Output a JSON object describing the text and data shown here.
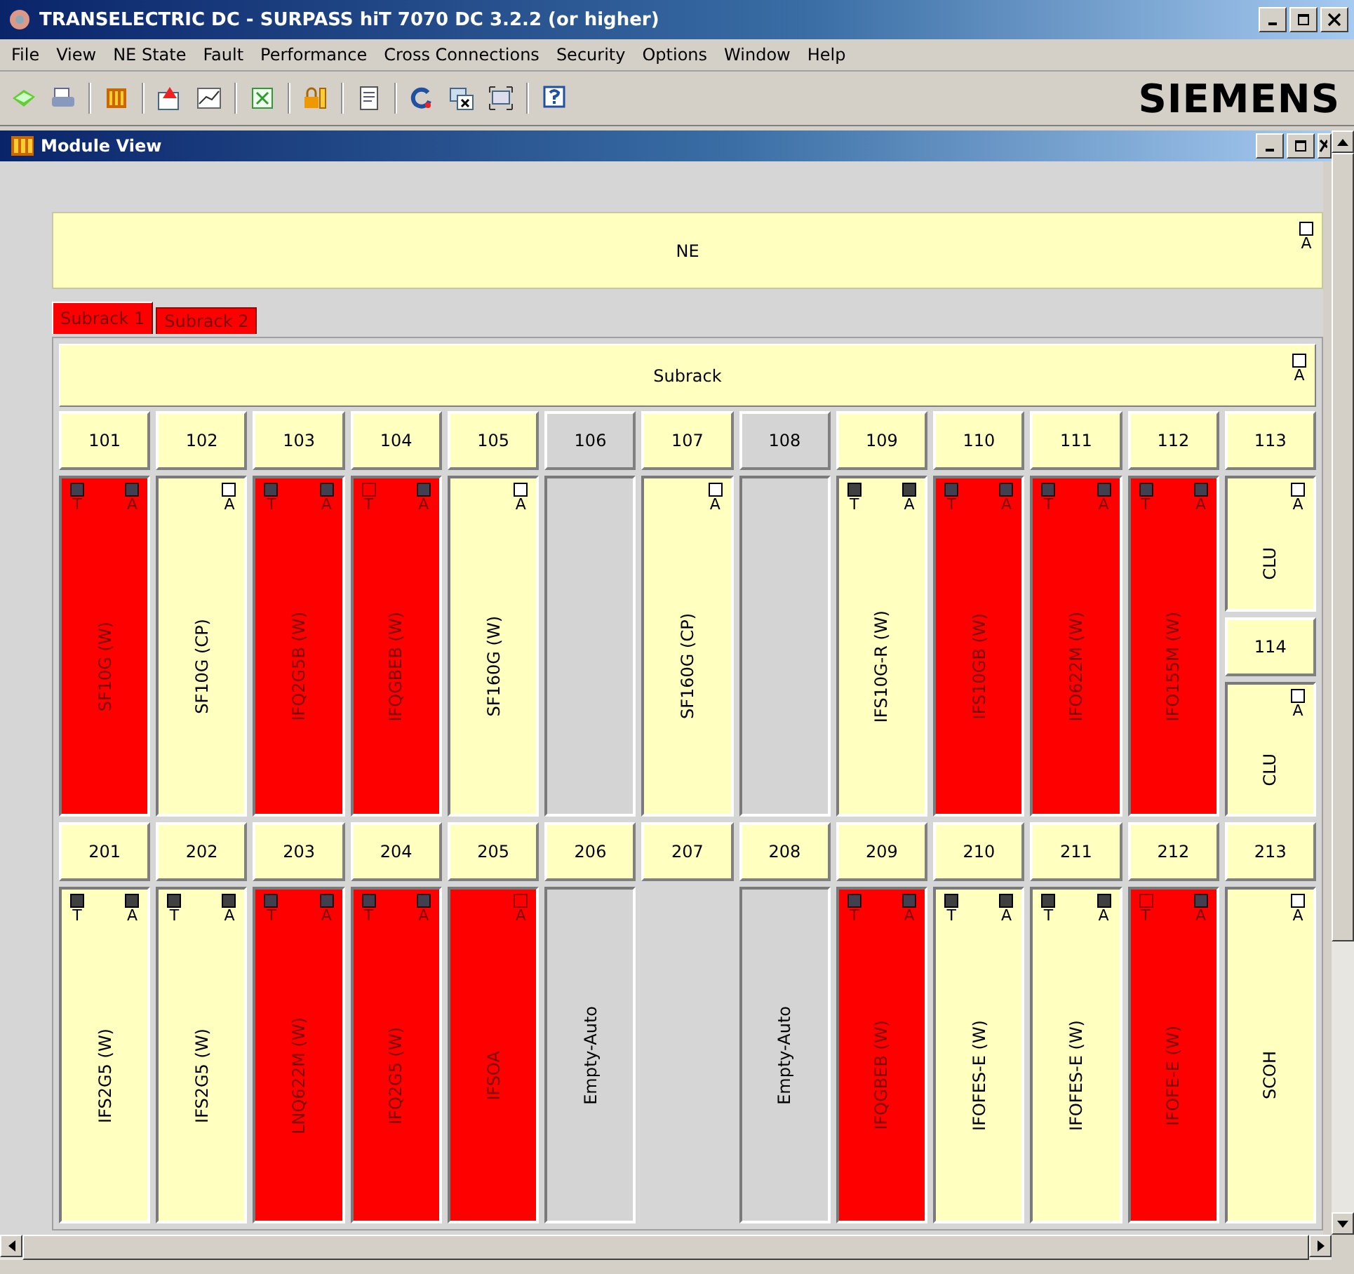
{
  "window": {
    "title": "TRANSELECTRIC DC -  SURPASS hiT 7070 DC 3.2.2 (or higher)"
  },
  "menu": [
    "File",
    "View",
    "NE State",
    "Fault",
    "Performance",
    "Cross Connections",
    "Security",
    "Options",
    "Window",
    "Help"
  ],
  "toolbar": {
    "logo": "SIEMENS"
  },
  "module_view": {
    "title": "Module View",
    "ne": {
      "label": "NE",
      "indicators": [
        {
          "label": "A",
          "on": false
        }
      ]
    },
    "tabs": [
      {
        "label": "Subrack 1",
        "selected": true
      },
      {
        "label": "Subrack 2",
        "selected": false
      }
    ],
    "subrack": {
      "label": "Subrack",
      "indicators": [
        {
          "label": "A",
          "on": false
        }
      ]
    },
    "rows": [
      {
        "slots": [
          {
            "number": "101",
            "module": {
              "kind": "alarm",
              "name": "SF10G (W)",
              "indicators": [
                {
                  "label": "T",
                  "on": true
                },
                {
                  "label": "A",
                  "on": true
                }
              ]
            }
          },
          {
            "number": "102",
            "module": {
              "kind": "normal",
              "name": "SF10G (CP)",
              "indicators": [
                {
                  "label": "A",
                  "on": false
                }
              ]
            }
          },
          {
            "number": "103",
            "module": {
              "kind": "alarm",
              "name": "IFQ2G5B (W)",
              "indicators": [
                {
                  "label": "T",
                  "on": true
                },
                {
                  "label": "A",
                  "on": true
                }
              ]
            }
          },
          {
            "number": "104",
            "module": {
              "kind": "alarm",
              "name": "IFQGBEB (W)",
              "indicators": [
                {
                  "label": "T",
                  "on": false
                },
                {
                  "label": "A",
                  "on": true
                }
              ]
            }
          },
          {
            "number": "105",
            "module": {
              "kind": "normal",
              "name": "SF160G (W)",
              "indicators": [
                {
                  "label": "A",
                  "on": false
                }
              ]
            }
          },
          {
            "number": "106",
            "module": {
              "kind": "empty"
            }
          },
          {
            "number": "107",
            "module": {
              "kind": "normal",
              "name": "SF160G (CP)",
              "indicators": [
                {
                  "label": "A",
                  "on": false
                }
              ]
            }
          },
          {
            "number": "108",
            "module": {
              "kind": "empty"
            }
          },
          {
            "number": "109",
            "module": {
              "kind": "normal",
              "name": "IFS10G-R (W)",
              "indicators": [
                {
                  "label": "T",
                  "on": true
                },
                {
                  "label": "A",
                  "on": true
                }
              ]
            }
          },
          {
            "number": "110",
            "module": {
              "kind": "alarm",
              "name": "IFS10GB (W)",
              "indicators": [
                {
                  "label": "T",
                  "on": true
                },
                {
                  "label": "A",
                  "on": true
                }
              ]
            }
          },
          {
            "number": "111",
            "module": {
              "kind": "alarm",
              "name": "IFO622M (W)",
              "indicators": [
                {
                  "label": "T",
                  "on": true
                },
                {
                  "label": "A",
                  "on": true
                }
              ]
            }
          },
          {
            "number": "112",
            "module": {
              "kind": "alarm",
              "name": "IFO155M (W)",
              "indicators": [
                {
                  "label": "T",
                  "on": true
                },
                {
                  "label": "A",
                  "on": true
                }
              ]
            }
          },
          {
            "number": "113",
            "module": {
              "kind": "normal",
              "name": "CLU",
              "indicators": [
                {
                  "label": "A",
                  "on": false
                }
              ]
            },
            "sub_slots": [
              {
                "number": "114",
                "module": {
                  "kind": "normal",
                  "name": "CLU",
                  "indicators": [
                    {
                      "label": "A",
                      "on": false
                    }
                  ]
                }
              }
            ]
          }
        ]
      },
      {
        "slots": [
          {
            "number": "201",
            "module": {
              "kind": "normal",
              "name": "IFS2G5 (W)",
              "indicators": [
                {
                  "label": "T",
                  "on": true
                },
                {
                  "label": "A",
                  "on": true
                }
              ]
            }
          },
          {
            "number": "202",
            "module": {
              "kind": "normal",
              "name": "IFS2G5 (W)",
              "indicators": [
                {
                  "label": "T",
                  "on": true
                },
                {
                  "label": "A",
                  "on": true
                }
              ]
            }
          },
          {
            "number": "203",
            "module": {
              "kind": "alarm",
              "name": "LNQ622M (W)",
              "indicators": [
                {
                  "label": "T",
                  "on": true
                },
                {
                  "label": "A",
                  "on": true
                }
              ]
            }
          },
          {
            "number": "204",
            "module": {
              "kind": "alarm",
              "name": "IFQ2G5 (W)",
              "indicators": [
                {
                  "label": "T",
                  "on": true
                },
                {
                  "label": "A",
                  "on": true
                }
              ]
            }
          },
          {
            "number": "205",
            "module": {
              "kind": "alarm",
              "name": "IFSOA",
              "indicators": [
                {
                  "label": "A",
                  "on": false
                }
              ]
            }
          },
          {
            "number": "206",
            "module": {
              "kind": "empty",
              "name": "Empty-Auto"
            }
          },
          {
            "number": "207"
          },
          {
            "number": "208",
            "module": {
              "kind": "empty",
              "name": "Empty-Auto"
            }
          },
          {
            "number": "209",
            "module": {
              "kind": "alarm",
              "name": "IFQGBEB (W)",
              "indicators": [
                {
                  "label": "T",
                  "on": true
                },
                {
                  "label": "A",
                  "on": true
                }
              ]
            }
          },
          {
            "number": "210",
            "module": {
              "kind": "normal",
              "name": "IFOFES-E (W)",
              "indicators": [
                {
                  "label": "T",
                  "on": true
                },
                {
                  "label": "A",
                  "on": true
                }
              ]
            }
          },
          {
            "number": "211",
            "module": {
              "kind": "normal",
              "name": "IFOFES-E (W)",
              "indicators": [
                {
                  "label": "T",
                  "on": true
                },
                {
                  "label": "A",
                  "on": true
                }
              ]
            }
          },
          {
            "number": "212",
            "module": {
              "kind": "alarm",
              "name": "IFOFE-E (W)",
              "indicators": [
                {
                  "label": "T",
                  "on": false
                },
                {
                  "label": "A",
                  "on": true
                }
              ]
            }
          },
          {
            "number": "213",
            "module": {
              "kind": "normal",
              "name": "SCOH",
              "indicators": [
                {
                  "label": "A",
                  "on": false
                }
              ]
            }
          }
        ]
      }
    ]
  }
}
